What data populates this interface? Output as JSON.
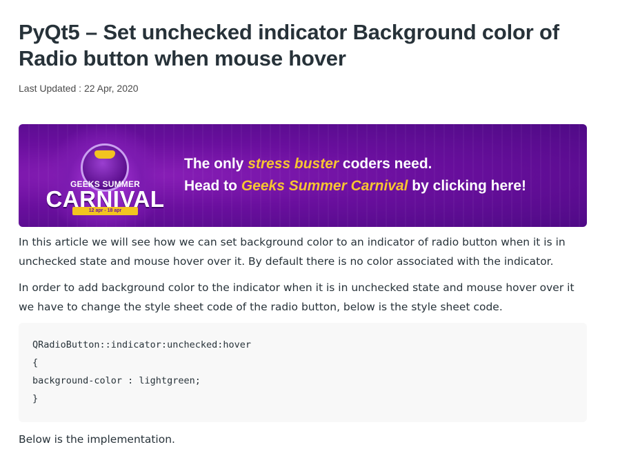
{
  "article": {
    "title": "PyQt5 – Set unchecked indicator Background color of Radio button when mouse hover",
    "last_updated": "Last Updated : 22 Apr, 2020"
  },
  "banner": {
    "logo_sub": "GEEKS SUMMER",
    "logo_big": "CARNIVAL",
    "logo_dates": "12 apr - 18 apr",
    "line1_a": "The only ",
    "line1_hl": "stress buster",
    "line1_b": " coders need.",
    "line2_a": "Head to ",
    "line2_hl": "Geeks Summer Carnival",
    "line2_b": " by clicking here!",
    "colors": {
      "background": "#6a0f9e",
      "highlight": "#f7c531"
    }
  },
  "paragraphs": {
    "intro": "In this article we will see how we can set background color to an indicator of radio button when it is in unchecked state and mouse hover over it. By default there is no color associated with the indicator.",
    "detail": "In order to add background color to the indicator when it is in unchecked state and mouse hover over it we have to change the style sheet code of the radio button, below is the style sheet code.",
    "outro": "Below is the implementation."
  },
  "code": {
    "line1": "QRadioButton::indicator:unchecked:hover",
    "line2": "{",
    "line3": "background-color : lightgreen;",
    "line4": "}"
  }
}
